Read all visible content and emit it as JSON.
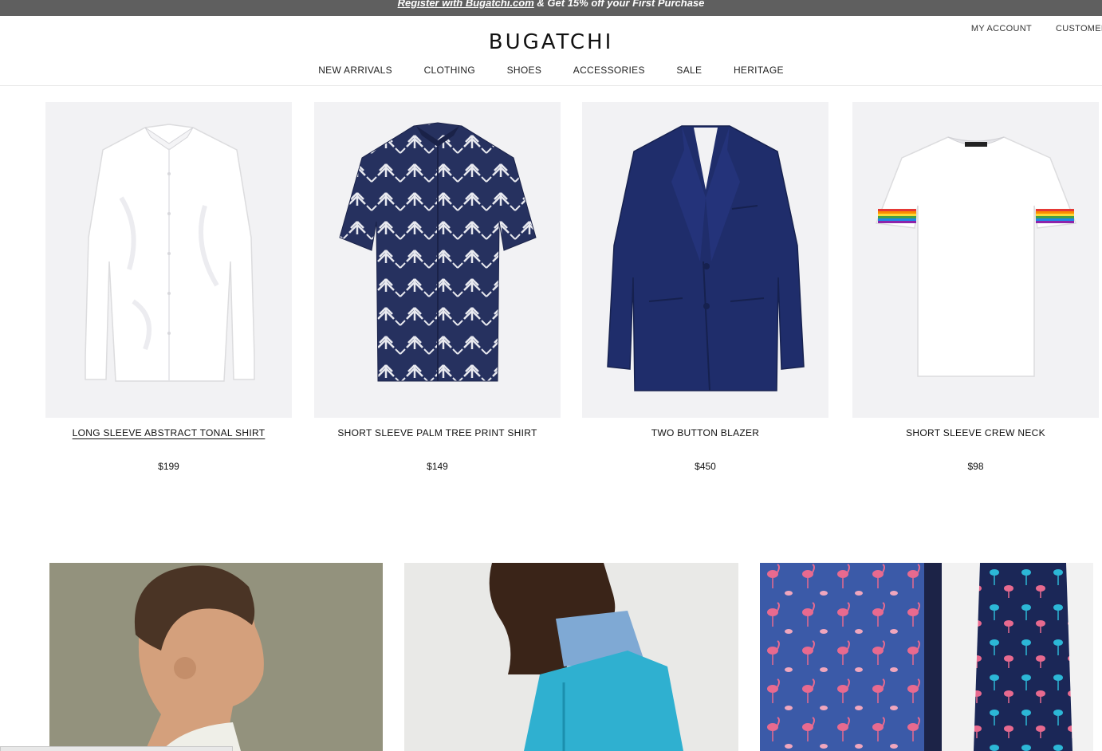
{
  "promo": {
    "link_text": "Register with Bugatchi.com",
    "rest_text": " & Get 15% off your First Purchase"
  },
  "header": {
    "logo": "BUGATCHI",
    "util_links": [
      "MY ACCOUNT",
      "CUSTOMER"
    ]
  },
  "nav": {
    "items": [
      "NEW ARRIVALS",
      "CLOTHING",
      "SHOES",
      "ACCESSORIES",
      "SALE",
      "HERITAGE"
    ]
  },
  "products": [
    {
      "name": "LONG SLEEVE ABSTRACT TONAL SHIRT",
      "price": "$199",
      "icon": "white-shirt-image"
    },
    {
      "name": "SHORT SLEEVE PALM TREE PRINT SHIRT",
      "price": "$149",
      "icon": "palm-print-shirt-image"
    },
    {
      "name": "TWO BUTTON BLAZER",
      "price": "$450",
      "icon": "navy-blazer-image"
    },
    {
      "name": "SHORT SLEEVE CREW NECK",
      "price": "$98",
      "icon": "crew-neck-tee-image"
    }
  ],
  "banners": [
    {
      "icon": "model-portrait-image"
    },
    {
      "icon": "model-polo-image"
    },
    {
      "icon": "flamingo-tie-image"
    }
  ],
  "colors": {
    "promo_bg": "#5f5f5f",
    "product_bg": "#f2f2f4",
    "navy": "#1f2d6b"
  }
}
